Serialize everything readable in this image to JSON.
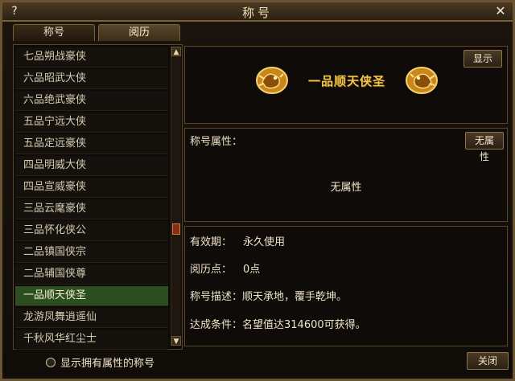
{
  "window": {
    "title": "称号",
    "help_label": "?",
    "close_label": "✕"
  },
  "tabs": [
    {
      "label": "称号",
      "active": false
    },
    {
      "label": "阅历",
      "active": true
    }
  ],
  "title_list": {
    "items": [
      "七品朔战豪侠",
      "六品昭武大侠",
      "六品绝武豪侠",
      "五品宁远大侠",
      "五品定远豪侠",
      "四品明威大侠",
      "四品宣威豪侠",
      "三品云麾豪侠",
      "三品怀化侠公",
      "二品镇国侠宗",
      "二品辅国侠尊",
      "一品顺天侠圣",
      "龙游凤舞逍遥仙",
      "千秋风华红尘士"
    ],
    "selected_index": 11
  },
  "title_panel": {
    "show_button": "显示",
    "title_text": "一品顺天侠圣"
  },
  "attributes": {
    "label": "称号属性：",
    "button": "无属性",
    "value": "无属性"
  },
  "info": {
    "validity_label": "有效期：",
    "validity_value": "永久使用",
    "exp_label": "阅历点：",
    "exp_value": "0点",
    "desc_label": "称号描述：",
    "desc_value": "顺天承地，覆手乾坤。",
    "cond_label": "达成条件：",
    "cond_value": "名望值达314600可获得。"
  },
  "footer": {
    "checkbox_label": "显示拥有属性的称号",
    "close_button": "关闭"
  },
  "colors": {
    "selected_row": "#2c4e20",
    "title_gold": "#f1c64a",
    "border": "#6b5431"
  }
}
